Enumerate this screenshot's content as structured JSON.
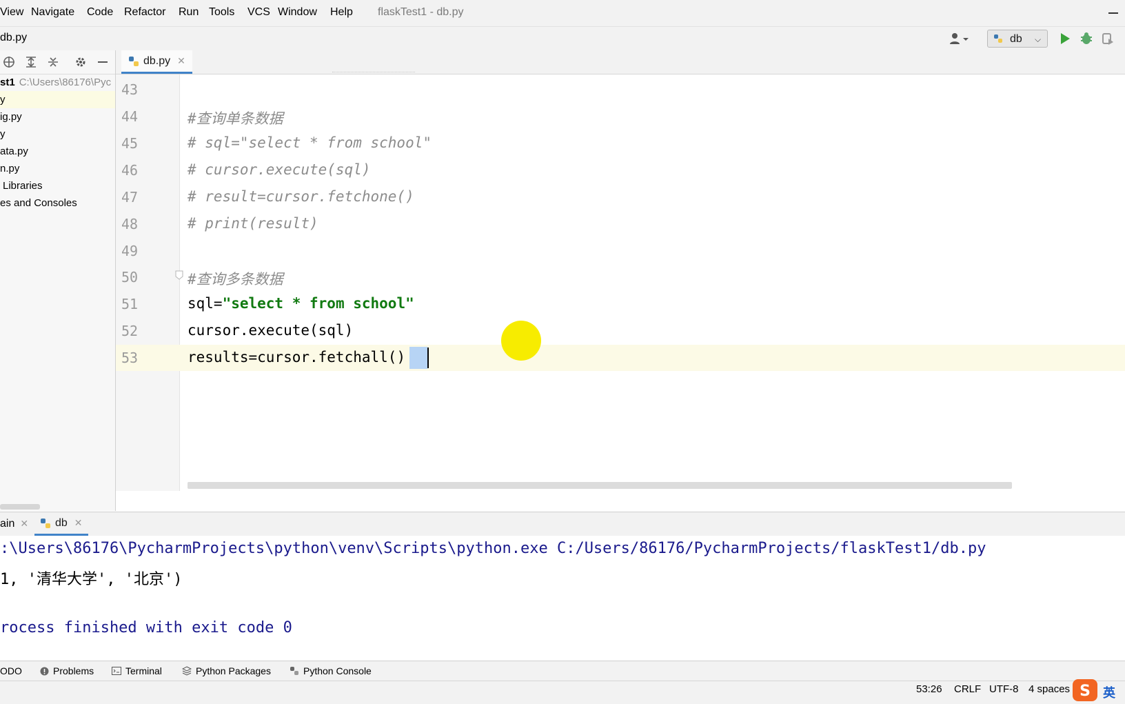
{
  "window_title": "flaskTest1 - db.py",
  "menu": [
    "View",
    "Navigate",
    "Code",
    "Refactor",
    "Run",
    "Tools",
    "VCS",
    "Window",
    "Help"
  ],
  "nav": {
    "file": "db.py",
    "run_config": "db"
  },
  "project": {
    "root_name": "st1",
    "root_path": "C:\\Users\\86176\\Pyc",
    "items": [
      "y",
      "ig.py",
      "y",
      "ata.py",
      "n.py",
      "Libraries",
      "es and Consoles"
    ]
  },
  "editor": {
    "tab": "db.py",
    "line_numbers": [
      "43",
      "44",
      "45",
      "46",
      "47",
      "48",
      "49",
      "50",
      "51",
      "52",
      "53"
    ],
    "lines": {
      "l44": "#查询单条数据",
      "l45": "# sql=\"select * from school\"",
      "l46": "# cursor.execute(sql)",
      "l47": "# result=cursor.fetchone()",
      "l48": "# print(result)",
      "l50": "#查询多条数据",
      "l51a": "sql=",
      "l51b": "\"select * from school\"",
      "l52": "cursor.execute(sql)",
      "l53a": "results=cursor.fetchall",
      "l53b": "()"
    }
  },
  "run": {
    "tab_main": "ain",
    "tab_db": "db",
    "console": [
      ":\\Users\\86176\\PycharmProjects\\python\\venv\\Scripts\\python.exe C:/Users/86176/PycharmProjects/flaskTest1/db.py",
      "1, '清华大学', '北京')",
      "",
      "rocess finished with exit code 0"
    ]
  },
  "tool_tabs": [
    "ODO",
    "Problems",
    "Terminal",
    "Python Packages",
    "Python Console"
  ],
  "status": {
    "position": "53:26",
    "line_sep": "CRLF",
    "encoding": "UTF-8",
    "indent": "4 spaces",
    "ime": "英"
  }
}
